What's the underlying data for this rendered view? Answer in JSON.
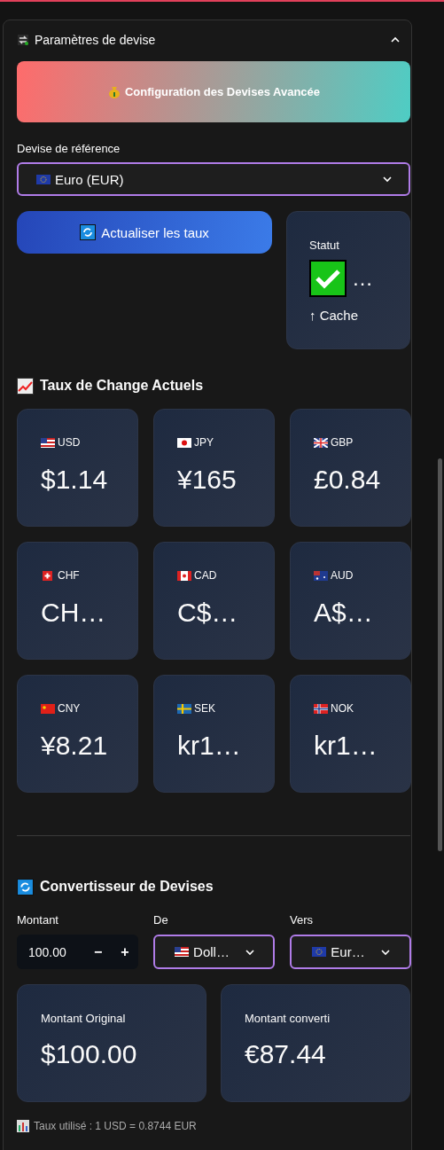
{
  "expander": {
    "title": "Paramètres de devise",
    "expanded": true
  },
  "banner": {
    "title": "Configuration des Devises Avancée"
  },
  "reference": {
    "label": "Devise de référence",
    "value": "Euro (EUR)"
  },
  "refresh_button": {
    "label": "Actualiser les taux"
  },
  "status": {
    "label": "Statut",
    "value": "…",
    "trend": "↑ Cache"
  },
  "rates": {
    "title": "Taux de Change Actuels",
    "cards": [
      {
        "code": "USD",
        "value": "$1.14"
      },
      {
        "code": "JPY",
        "value": "¥165"
      },
      {
        "code": "GBP",
        "value": "£0.84"
      },
      {
        "code": "CHF",
        "value": "CH…"
      },
      {
        "code": "CAD",
        "value": "C$…"
      },
      {
        "code": "AUD",
        "value": "A$…"
      },
      {
        "code": "CNY",
        "value": "¥8.21"
      },
      {
        "code": "SEK",
        "value": "kr1…"
      },
      {
        "code": "NOK",
        "value": "kr1…"
      }
    ]
  },
  "converter": {
    "title": "Convertisseur de Devises",
    "amount": {
      "label": "Montant",
      "value": "100.00",
      "minus": "−",
      "plus": "+"
    },
    "from": {
      "label": "De",
      "value": "Doll…"
    },
    "to": {
      "label": "Vers",
      "value": "Eur…"
    },
    "results": [
      {
        "label": "Montant Original",
        "value": "$100.00"
      },
      {
        "label": "Montant converti",
        "value": "€87.44"
      }
    ],
    "note": "Taux utilisé : 1 USD = 0.8744 EUR"
  }
}
